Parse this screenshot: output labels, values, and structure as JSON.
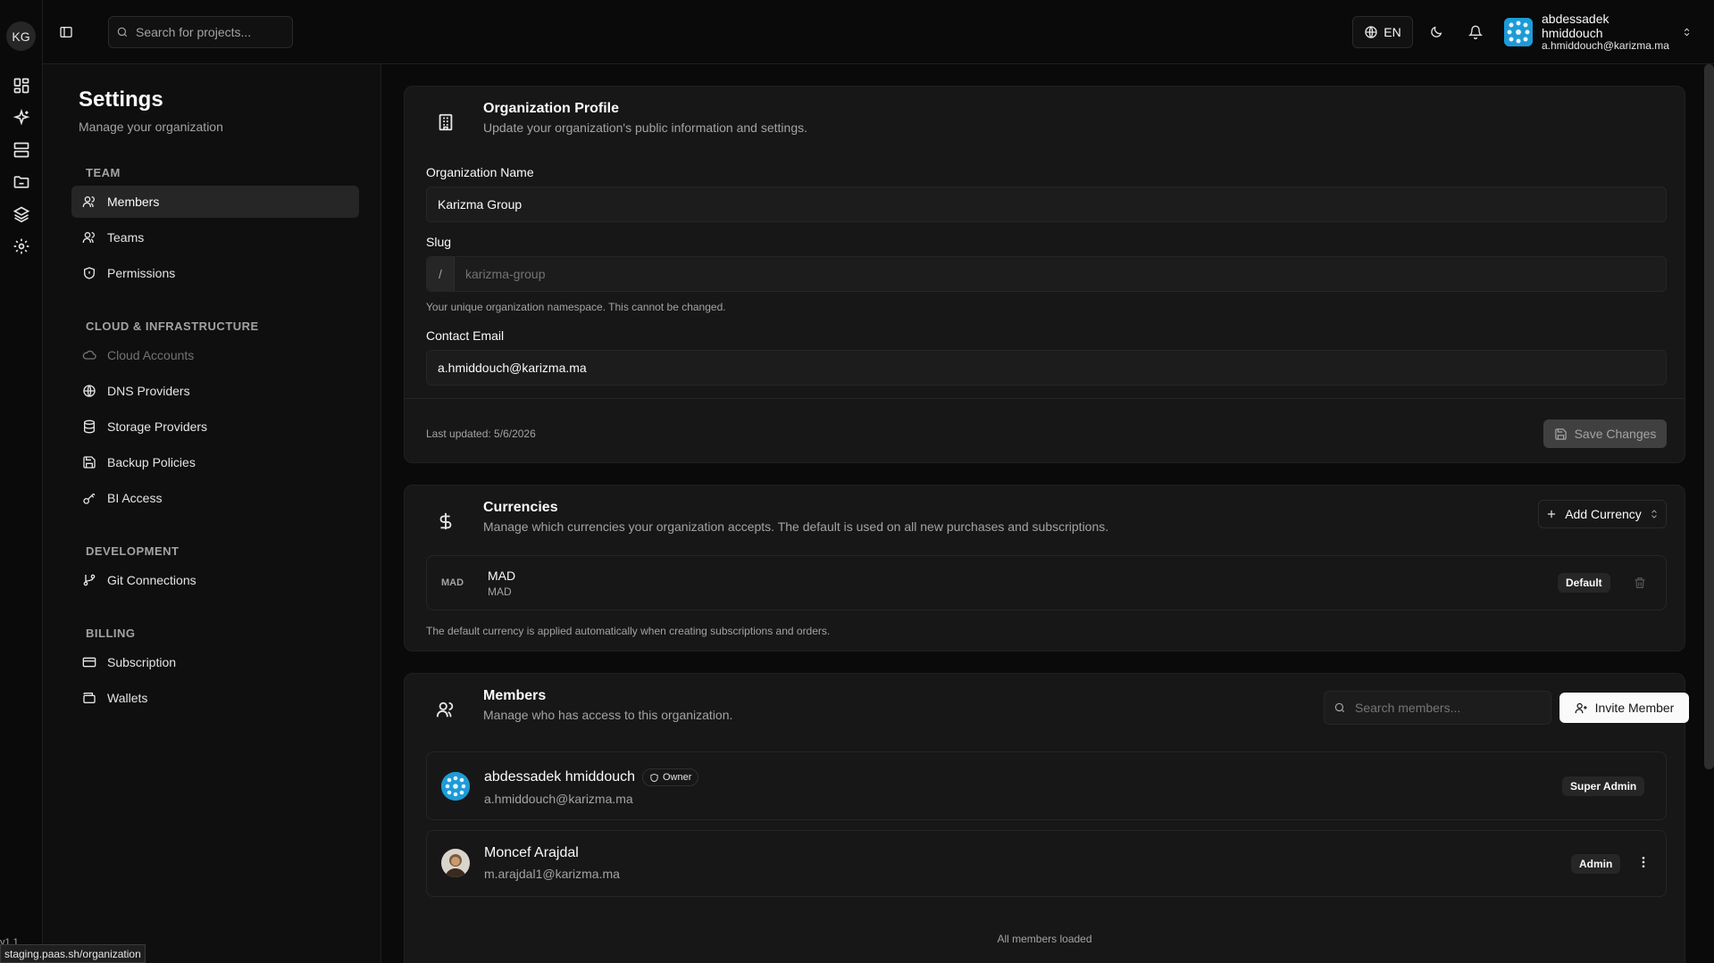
{
  "rail": {
    "logo": "KG",
    "version": "v1.1",
    "icons": [
      "dashboard-icon",
      "sparkles-icon",
      "servers-icon",
      "folder-icon",
      "layers-icon",
      "gear-icon"
    ]
  },
  "topbar": {
    "search_placeholder": "Search for projects...",
    "language": "EN",
    "user": {
      "name": "abdessadek hmiddouch",
      "email": "a.hmiddouch@karizma.ma"
    }
  },
  "settings": {
    "title": "Settings",
    "subtitle": "Manage your organization",
    "sections": {
      "team": "TEAM",
      "cloud": "CLOUD & INFRASTRUCTURE",
      "development": "DEVELOPMENT",
      "billing": "BILLING"
    },
    "items": {
      "members": "Members",
      "teams": "Teams",
      "permissions": "Permissions",
      "cloud_accounts": "Cloud Accounts",
      "dns_providers": "DNS Providers",
      "storage_providers": "Storage Providers",
      "backup_policies": "Backup Policies",
      "bi_access": "BI Access",
      "git_connections": "Git Connections",
      "subscription": "Subscription",
      "wallets": "Wallets"
    }
  },
  "org_profile": {
    "title": "Organization Profile",
    "description": "Update your organization's public information and settings.",
    "name_label": "Organization Name",
    "name_value": "Karizma Group",
    "slug_label": "Slug",
    "slug_prefix": "/",
    "slug_value": "karizma-group",
    "slug_hint": "Your unique organization namespace. This cannot be changed.",
    "email_label": "Contact Email",
    "email_value": "a.hmiddouch@karizma.ma",
    "last_updated": "Last updated: 5/6/2026",
    "save_label": "Save Changes"
  },
  "currencies": {
    "title": "Currencies",
    "description": "Manage which currencies your organization accepts. The default is used on all new purchases and subscriptions.",
    "add_label": "Add Currency",
    "items": [
      {
        "code_tag": "MAD",
        "name": "MAD",
        "code": "MAD",
        "badge": "Default"
      }
    ],
    "hint": "The default currency is applied automatically when creating subscriptions and orders."
  },
  "members": {
    "title": "Members",
    "description": "Manage who has access to this organization.",
    "search_placeholder": "Search members...",
    "invite_label": "Invite Member",
    "list": [
      {
        "name": "abdessadek hmiddouch",
        "email": "a.hmiddouch@karizma.ma",
        "tag": "Owner",
        "role": "Super Admin"
      },
      {
        "name": "Moncef Arajdal",
        "email": "m.arajdal1@karizma.ma",
        "role": "Admin"
      }
    ],
    "footer": "All members loaded"
  },
  "status_bar": {
    "url": "staging.paas.sh/organization"
  },
  "colors": {
    "background": "#0a0a0a",
    "card": "#171717",
    "accent": "#fafafa",
    "avatar_blue": "#1d9bd7"
  }
}
